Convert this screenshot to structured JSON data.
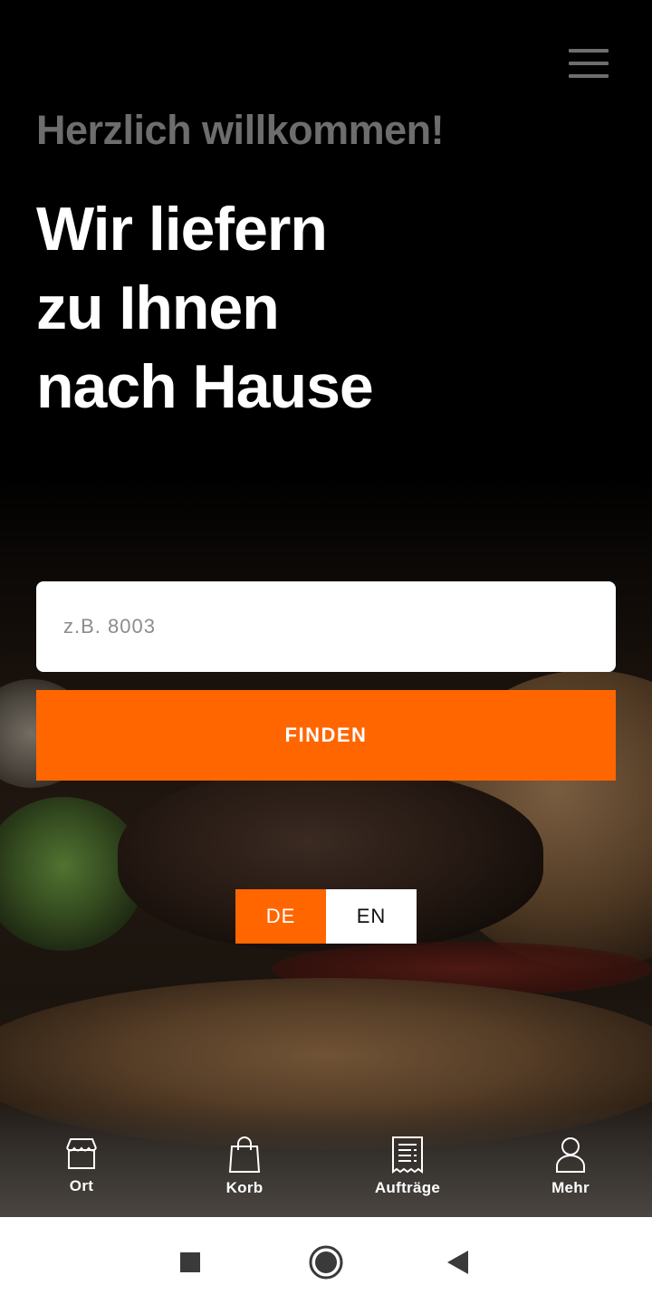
{
  "header": {
    "welcome": "Herzlich willkommen!",
    "headline_lines": [
      "Wir liefern",
      "zu Ihnen",
      "nach Hause"
    ]
  },
  "search": {
    "placeholder": "z.B. 8003",
    "value": "",
    "button_label": "FINDEN"
  },
  "language": {
    "options": [
      "DE",
      "EN"
    ],
    "selected": "DE"
  },
  "bottom_nav": {
    "items": [
      {
        "label": "Ort",
        "icon": "store-icon"
      },
      {
        "label": "Korb",
        "icon": "shopping-bag-icon"
      },
      {
        "label": "Aufträge",
        "icon": "receipt-icon"
      },
      {
        "label": "Mehr",
        "icon": "user-icon"
      }
    ]
  },
  "colors": {
    "accent": "#ff6600",
    "background": "#000000",
    "welcome_text": "#6d6d6d"
  }
}
